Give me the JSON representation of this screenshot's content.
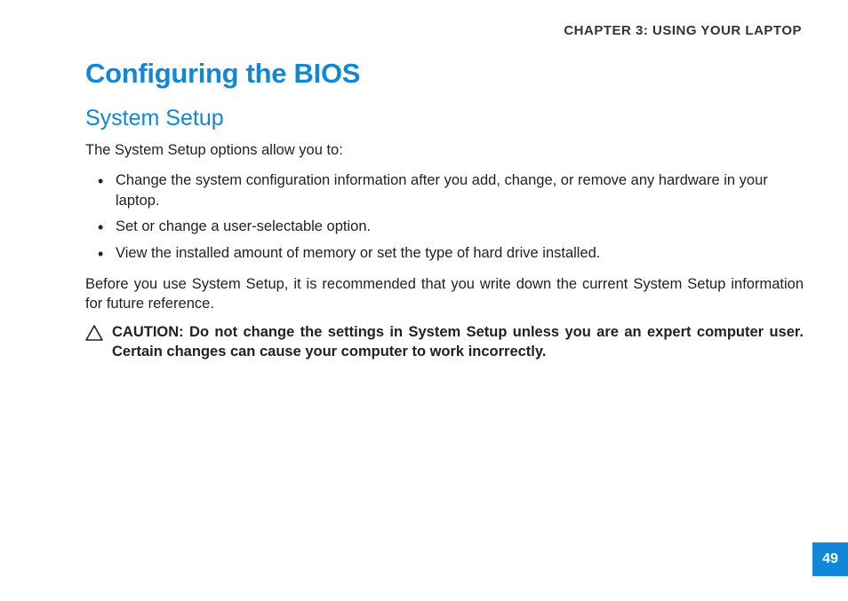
{
  "chapter_header": "CHAPTER 3: USING YOUR LAPTOP",
  "title": "Configuring the BIOS",
  "subtitle": "System Setup",
  "intro": "The System Setup options allow you to:",
  "bullets": [
    "Change the system configuration information after you add, change, or remove any hardware in your laptop.",
    "Set or change a user-selectable option.",
    "View the installed amount of memory or set the type of hard drive installed."
  ],
  "recommendation": "Before you use System Setup, it is recommended that you write down the current System Setup information for future reference.",
  "caution": "CAUTION: Do not change the settings in System Setup unless you are an expert computer user. Certain changes can cause your computer to work incorrectly.",
  "page_number": "49"
}
